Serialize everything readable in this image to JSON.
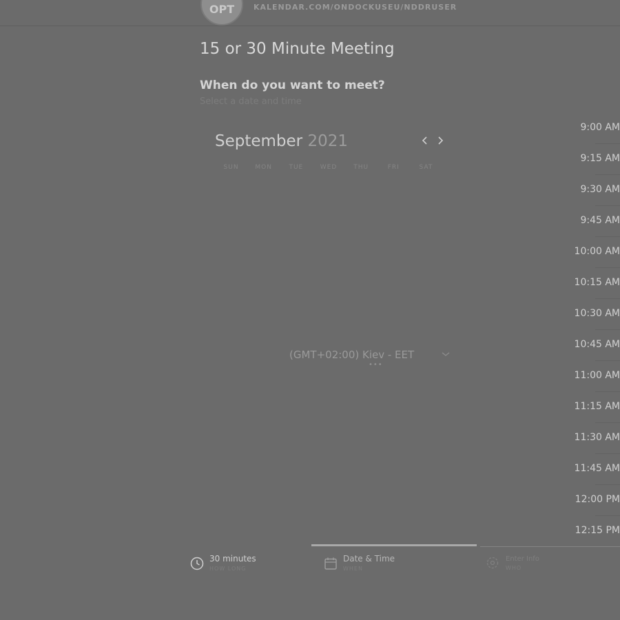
{
  "header": {
    "avatar_initials": "OPT",
    "url": "KALENDAR.COM/ONDOCKUSEU/NDDRUSER"
  },
  "event": {
    "title": "15 or 30 Minute Meeting"
  },
  "prompt": {
    "question": "When do you want to meet?",
    "subtext": "Select a date and time"
  },
  "calendar": {
    "month": "September",
    "year": "2021",
    "prev_icon": "chevron-left-icon",
    "next_icon": "chevron-right-icon",
    "weekdays": [
      "SUN",
      "MON",
      "TUE",
      "WED",
      "THU",
      "FRI",
      "SAT"
    ]
  },
  "timezone": {
    "label": "(GMT+02:00) Kiev - EET",
    "dots": "•••"
  },
  "slots": [
    "9:00 AM",
    "9:15 AM",
    "9:30 AM",
    "9:45 AM",
    "10:00 AM",
    "10:15 AM",
    "10:30 AM",
    "10:45 AM",
    "11:00 AM",
    "11:15 AM",
    "11:30 AM",
    "11:45 AM",
    "12:00 PM",
    "12:15 PM"
  ],
  "steps": {
    "progress": 0.5,
    "duration": {
      "title": "30 minutes",
      "sub": "HOW LONG"
    },
    "datetime": {
      "title": "Date & Time",
      "sub": "WHEN"
    },
    "enter": {
      "title": "Enter Info",
      "sub": "WHO"
    }
  },
  "colors": {
    "background": "#6b6b6b",
    "text_primary": "#d4d4d4",
    "text_muted": "#7c7c7c"
  }
}
